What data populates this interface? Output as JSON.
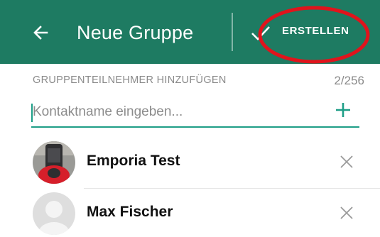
{
  "colors": {
    "app_bar": "#1e7b62",
    "accent": "#1e9e87",
    "annotation_ring": "#e0141c"
  },
  "app_bar": {
    "back_icon": "arrow-left-icon",
    "title": "Neue Gruppe",
    "create_icon": "check-icon",
    "create_label": "ERSTELLEN"
  },
  "participants": {
    "section_label": "GRUPPENTEILNEHMER HINZUFÜGEN",
    "count": "2/256",
    "search_placeholder": "Kontaktname eingeben...",
    "add_icon": "plus-icon",
    "contacts": [
      {
        "name": "Emporia Test",
        "avatar": "photo-avatar",
        "remove_icon": "close-icon"
      },
      {
        "name": "Max Fischer",
        "avatar": "default-avatar",
        "remove_icon": "close-icon"
      }
    ]
  }
}
